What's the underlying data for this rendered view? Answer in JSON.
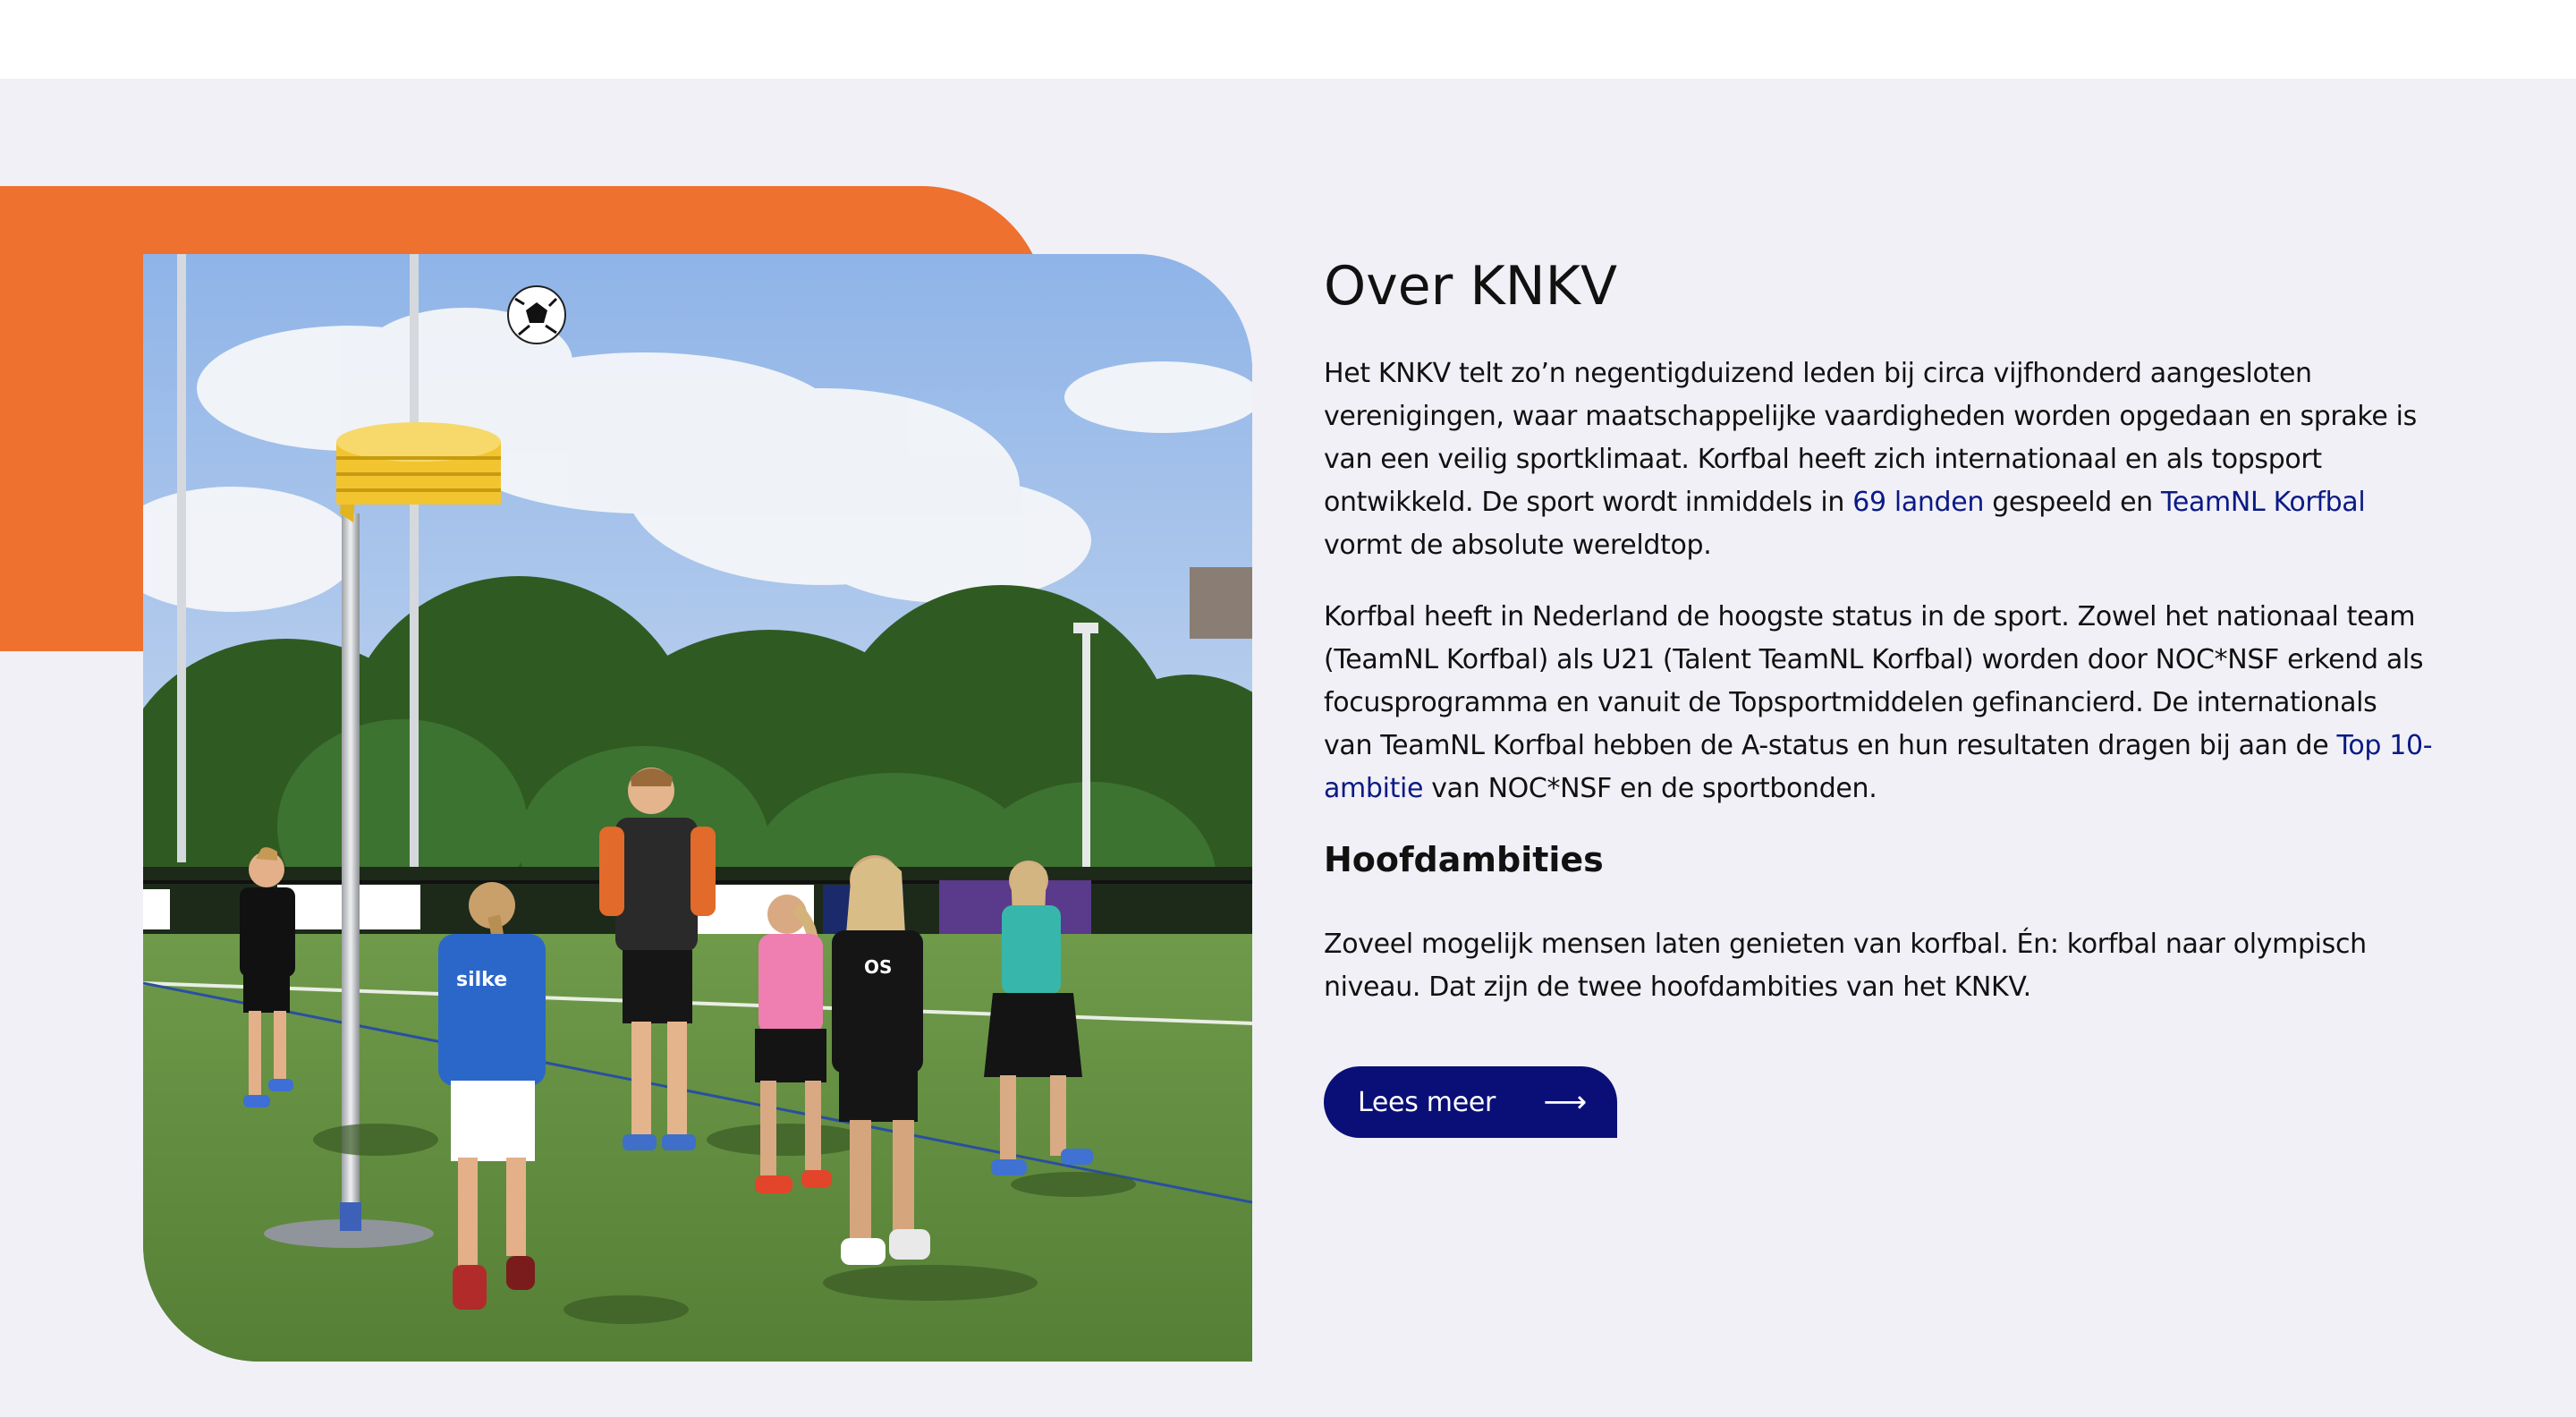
{
  "section": {
    "title": "Over KNKV",
    "para1": {
      "before": "Het KNKV telt zo’n negentigduizend leden bij circa vijfhonderd aangesloten verenigingen, waar maatschappelijke vaardigheden worden opgedaan en sprake is van een veilig sportklimaat. Korfbal heeft zich internationaal en als topsport ontwikkeld. De sport wordt inmiddels in ",
      "link1": "69 landen",
      "middle": " gespeeld en ",
      "link2": "TeamNL Korfbal",
      "after": " vormt de absolute wereldtop."
    },
    "para2": {
      "before": "Korfbal heeft in Nederland de hoogste status in de sport. Zowel het nationaal team (TeamNL Korfbal) als U21 (Talent TeamNL Korfbal) worden door NOC*NSF erkend als focusprogramma en vanuit de Topsportmiddelen gefinancierd. De internationals van TeamNL Korfbal hebben de A-status en hun resultaten dragen bij aan de ",
      "link": "Top 10-ambitie",
      "after": " van NOC*NSF en de sportbonden."
    },
    "subheading": "Hoofdambities",
    "para3": "Zoveel mogelijk mensen laten genieten van korfbal. Én: korfbal naar olympisch niveau. Dat zijn de twee hoofdambities van het KNKV.",
    "button_label": "Lees meer",
    "button_icon": "arrow-right-icon",
    "button_arrow": "⟶"
  },
  "image": {
    "shirt_text_1": "silke",
    "shirt_text_2": "OS"
  },
  "colors": {
    "background": "#f1f0f6",
    "accent_orange": "#ee7130",
    "button": "#0a0f78",
    "link": "#0a1a85"
  }
}
